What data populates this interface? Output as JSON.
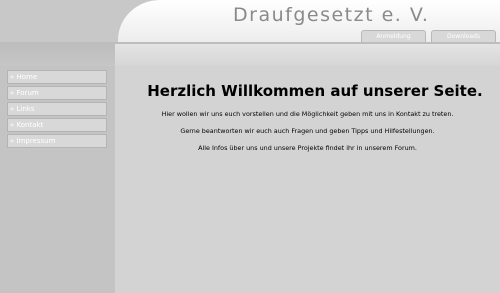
{
  "header": {
    "site_title": "Draufgesetzt e. V.",
    "top_links": [
      "Anmeldung",
      "Downloads"
    ]
  },
  "nav": {
    "items": [
      "» Home",
      "» Forum",
      "» Links",
      "» Kontakt",
      "» Impressum"
    ]
  },
  "main": {
    "heading": "Herzlich Willkommen auf unserer Seite.",
    "paragraphs": [
      "Hier wollen wir uns euch vorstellen und die Möglichkeit geben mit uns in Kontakt zu treten.",
      "Gerne beantworten wir euch auch Fragen und geben Tipps und Hilfestellungen.",
      "Alle Infos über uns und unsere Projekte findet ihr in unserem Forum."
    ]
  },
  "colors": {
    "background": "#d3d3d3",
    "header_panel": "#f4f4f4",
    "title_text": "#8a8a8a",
    "nav_text": "#ffffff"
  }
}
